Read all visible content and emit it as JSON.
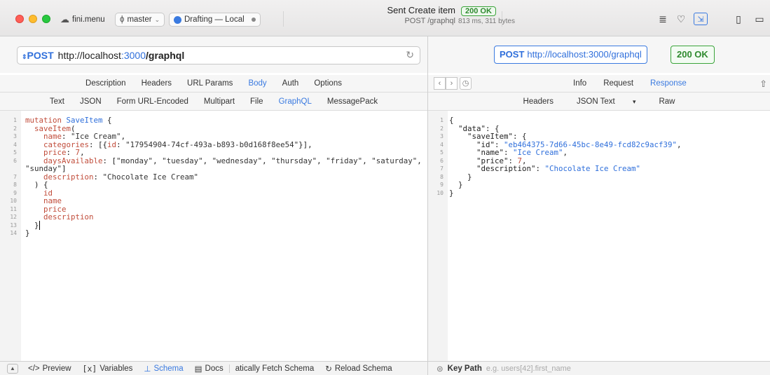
{
  "titlebar": {
    "project": "fini.menu",
    "branch": "master",
    "env": "Drafting — Local",
    "title": "Sent Create item",
    "subtitle": "POST /graphql",
    "status": "200 OK",
    "meta": "813 ms, 311 bytes"
  },
  "request": {
    "method": "POST",
    "url_host": "http://localhost",
    "url_port": ":3000",
    "url_path": "/graphql",
    "tabs": [
      "Description",
      "Headers",
      "URL Params",
      "Body",
      "Auth",
      "Options"
    ],
    "active_tab": "Body",
    "body_tabs": [
      "Text",
      "JSON",
      "Form URL-Encoded",
      "Multipart",
      "File",
      "GraphQL",
      "MessagePack"
    ],
    "active_body_tab": "GraphQL",
    "line_numbers": [
      "1",
      "2",
      "3",
      "4",
      "5",
      "6",
      "",
      "7",
      "8",
      "9",
      "10",
      "11",
      "12",
      "13",
      "14"
    ]
  },
  "bottom_left": {
    "preview": "Preview",
    "variables": "Variables",
    "schema": "Schema",
    "docs": "Docs",
    "fetch": "atically Fetch Schema",
    "reload": "Reload Schema"
  },
  "response": {
    "method": "POST",
    "url": "http://localhost:3000/graphql",
    "status": "200 OK",
    "tabs": [
      "Info",
      "Request",
      "Response"
    ],
    "active_tab": "Response",
    "view_tabs": [
      "Headers",
      "JSON Text",
      "Raw"
    ],
    "active_view_tab": "JSON Text",
    "line_numbers": [
      "1",
      "2",
      "3",
      "4",
      "5",
      "6",
      "7",
      "8",
      "9",
      "10"
    ],
    "key_path_label": "Key Path",
    "key_path_placeholder": "e.g. users[42].first_name"
  },
  "icons": [
    "cloud-icon",
    "branch-icon",
    "env-dot-icon",
    "refresh-icon",
    "share-icon",
    "history-icon"
  ]
}
